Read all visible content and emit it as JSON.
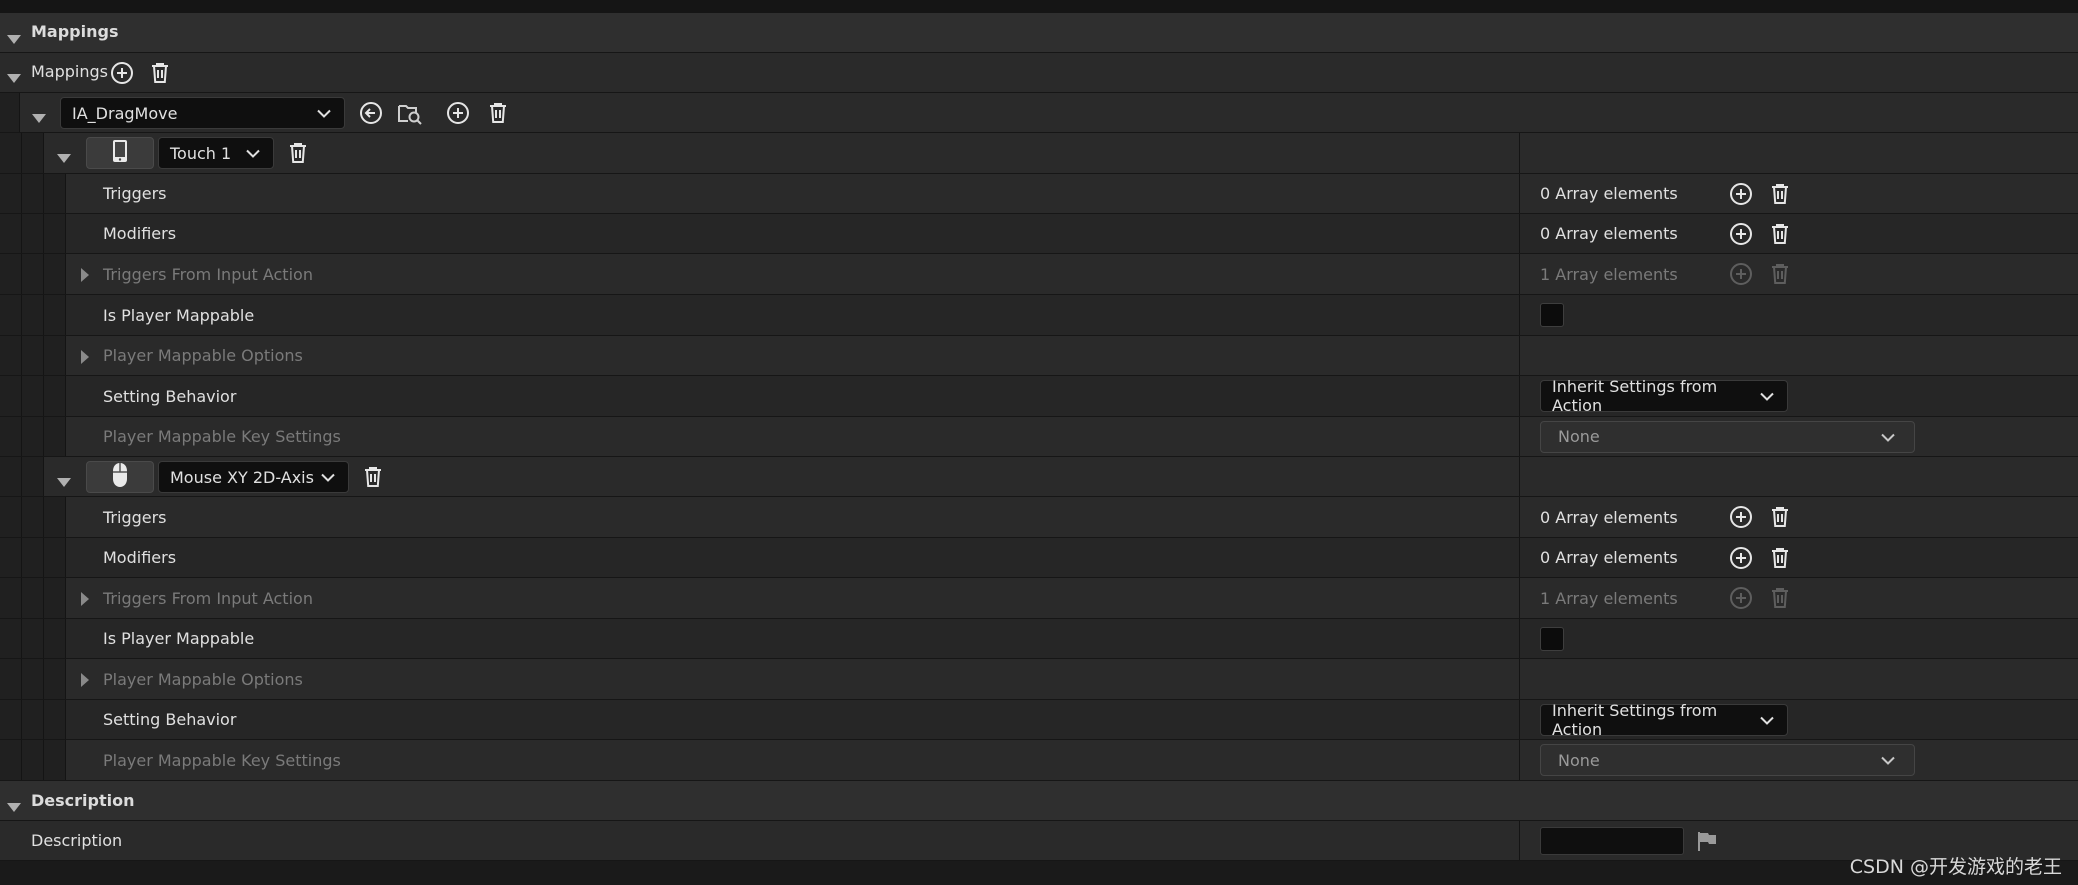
{
  "sections": {
    "mappings_title": "Mappings",
    "description_title": "Description"
  },
  "mappings_row": {
    "label": "Mappings"
  },
  "action": {
    "name": "IA_DragMove"
  },
  "keys": [
    {
      "key_label": "Touch 1",
      "device_icon": "phone-icon",
      "triggers": {
        "label": "Triggers",
        "value": "0 Array elements"
      },
      "modifiers": {
        "label": "Modifiers",
        "value": "0 Array elements"
      },
      "triggers_from_action": {
        "label": "Triggers From Input Action",
        "value": "1 Array elements"
      },
      "is_player_mappable": {
        "label": "Is Player Mappable",
        "checked": false
      },
      "player_mappable_options": {
        "label": "Player Mappable Options"
      },
      "setting_behavior": {
        "label": "Setting Behavior",
        "value": "Inherit Settings from Action"
      },
      "key_settings": {
        "label": "Player Mappable Key Settings",
        "value": "None"
      }
    },
    {
      "key_label": "Mouse XY 2D-Axis",
      "device_icon": "mouse-icon",
      "triggers": {
        "label": "Triggers",
        "value": "0 Array elements"
      },
      "modifiers": {
        "label": "Modifiers",
        "value": "0 Array elements"
      },
      "triggers_from_action": {
        "label": "Triggers From Input Action",
        "value": "1 Array elements"
      },
      "is_player_mappable": {
        "label": "Is Player Mappable",
        "checked": false
      },
      "player_mappable_options": {
        "label": "Player Mappable Options"
      },
      "setting_behavior": {
        "label": "Setting Behavior",
        "value": "Inherit Settings from Action"
      },
      "key_settings": {
        "label": "Player Mappable Key Settings",
        "value": "None"
      }
    }
  ],
  "description": {
    "label": "Description",
    "value": ""
  },
  "watermark": "CSDN @开发游戏的老王",
  "colors": {
    "background": "#1a1a1a",
    "category": "#2f2f2f",
    "row": "#2a2a2a",
    "text": "#e0e0e0",
    "dim_text": "#7a7a7a"
  }
}
